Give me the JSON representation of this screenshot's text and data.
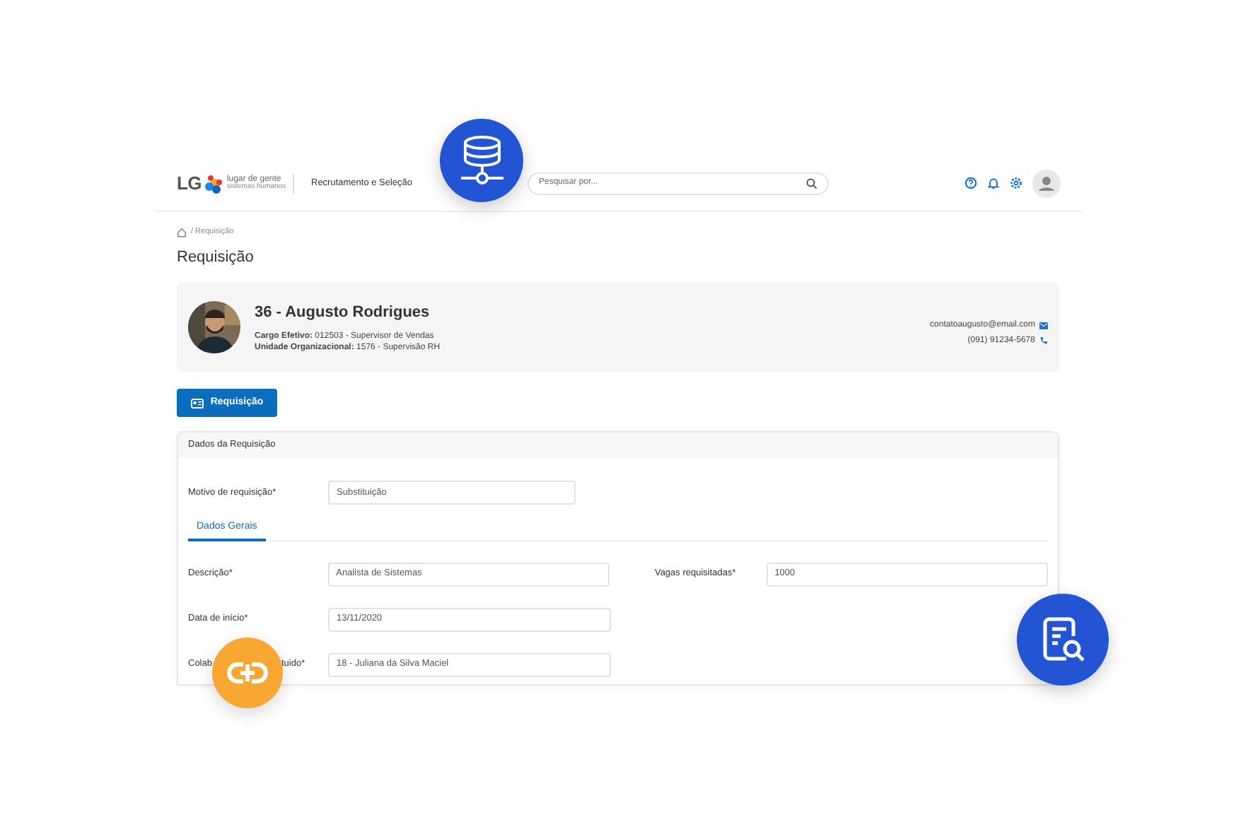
{
  "header": {
    "logo": {
      "mark": "LG",
      "tagline": "lugar de gente",
      "subtitle": "sistemas humanos"
    },
    "module": "Recrutamento e Seleção",
    "search": {
      "placeholder": "Pesquisar por..."
    }
  },
  "breadcrumb": "/ Requisição",
  "title": "Requisição",
  "profile": {
    "name": "36 - Augusto Rodrigues",
    "details": [
      "**Cargo Efetivo:** 012503 - Supervisor de Vendas",
      "**Unidade Organizacional:** 1576 - Supervisão RH"
    ],
    "email": "contatoaugusto@email.com",
    "phone": "(091) 91234-5678"
  },
  "action_button": "Requisição",
  "section": {
    "title": "Dados da Requisição",
    "reason": {
      "label": "Motivo de requisição*",
      "value": "Substituição"
    },
    "tabs": [
      {
        "label": "Dados Gerais",
        "selected": true
      }
    ],
    "rows": [
      [
        {
          "label": "Descrição*",
          "value": "Analista de Sistemas"
        },
        {
          "label": "Vagas requisitadas*",
          "value": "1000"
        }
      ],
      [
        {
          "label": "Data de início*",
          "value": "13/11/2020"
        }
      ],
      [
        {
          "label_parts": [
            "Colab",
            "tuido*"
          ],
          "value": "18 - Juliana da Silva Maciel"
        }
      ]
    ]
  }
}
